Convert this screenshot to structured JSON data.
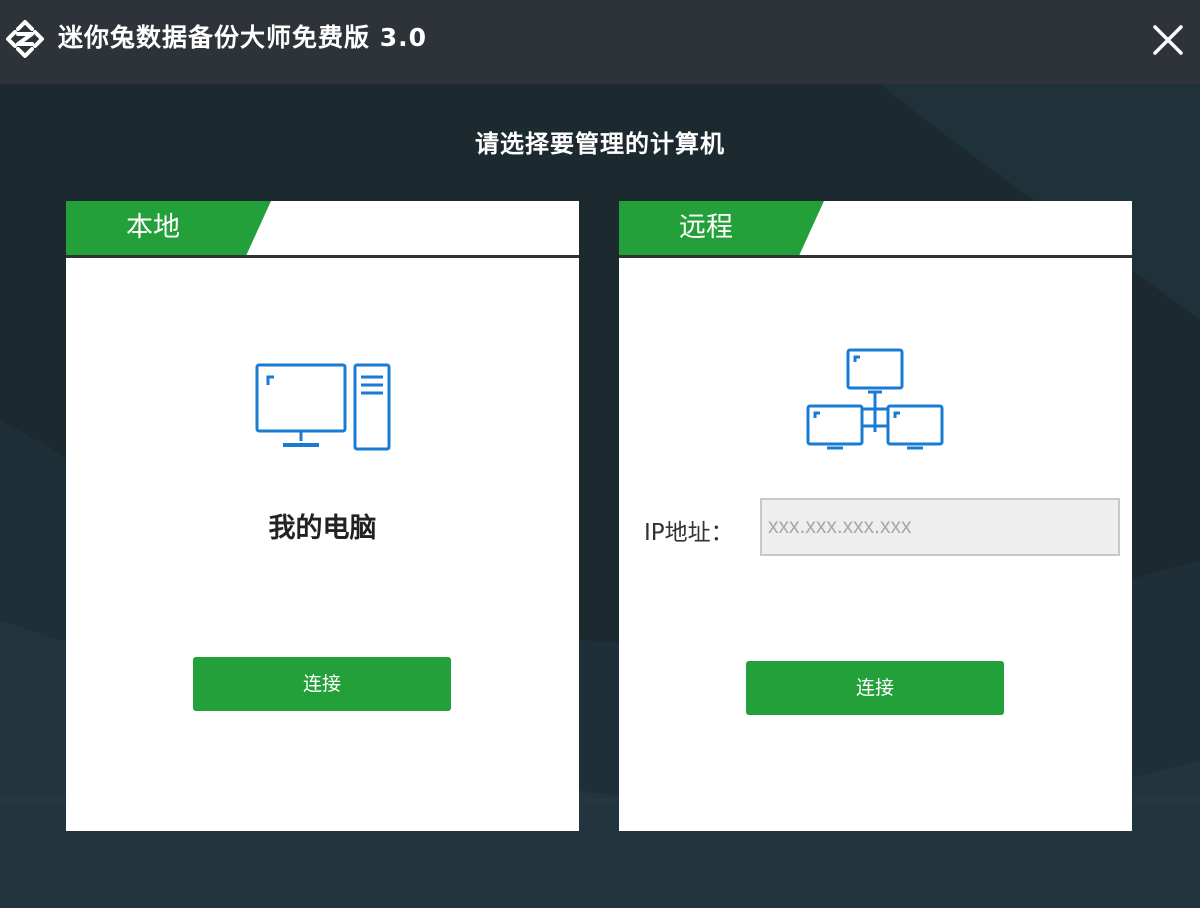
{
  "titlebar": {
    "app_title": "迷你兔数据备份大师免费版 3.0",
    "logo_icon": "app-logo-icon",
    "close_icon": "close-icon"
  },
  "main": {
    "subtitle": "请选择要管理的计算机"
  },
  "local_card": {
    "tab_label": "本地",
    "icon": "desktop-computer-icon",
    "computer_name": "我的电脑",
    "connect_label": "连接"
  },
  "remote_card": {
    "tab_label": "远程",
    "icon": "network-icon",
    "ip_label": "IP地址：",
    "ip_value": "",
    "ip_placeholder": "xxx.xxx.xxx.xxx",
    "connect_label": "连接"
  },
  "colors": {
    "accent_green": "#23a03a",
    "icon_blue": "#1a7bd4",
    "titlebar_bg": "#2d3338",
    "window_bg": "#1c2a30"
  }
}
